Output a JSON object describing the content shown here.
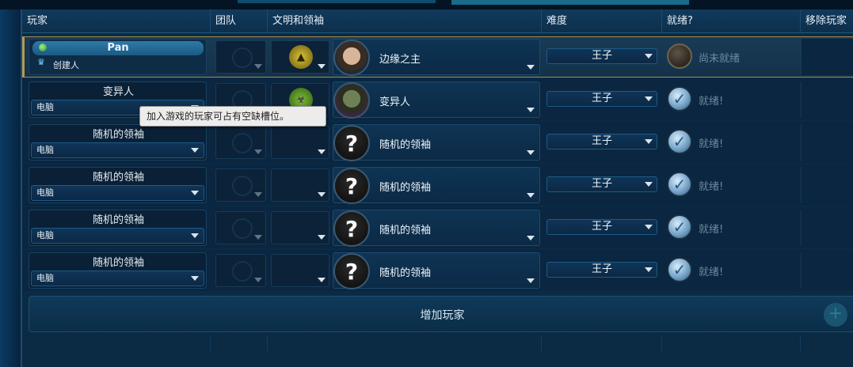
{
  "headers": {
    "player": "玩家",
    "team": "团队",
    "civ_leader": "文明和领袖",
    "difficulty": "难度",
    "ready": "就绪?",
    "remove": "移除玩家"
  },
  "rows": [
    {
      "name": "Pan",
      "subtitle": "创建人",
      "leader": "边缘之主",
      "difficulty": "王子",
      "ready_text": "尚未就绪",
      "ready": false
    },
    {
      "name": "变异人",
      "type": "电脑",
      "leader": "变异人",
      "difficulty": "王子",
      "ready_text": "就绪!",
      "ready": true
    },
    {
      "name": "随机的领袖",
      "type": "电脑",
      "leader": "随机的领袖",
      "difficulty": "王子",
      "ready_text": "就绪!",
      "ready": true
    },
    {
      "name": "随机的领袖",
      "type": "电脑",
      "leader": "随机的领袖",
      "difficulty": "王子",
      "ready_text": "就绪!",
      "ready": true
    },
    {
      "name": "随机的领袖",
      "type": "电脑",
      "leader": "随机的领袖",
      "difficulty": "王子",
      "ready_text": "就绪!",
      "ready": true
    },
    {
      "name": "随机的领袖",
      "type": "电脑",
      "leader": "随机的领袖",
      "difficulty": "王子",
      "ready_text": "就绪!",
      "ready": true
    }
  ],
  "add_player": "增加玩家",
  "tooltip": "加入游戏的玩家可占有空缺槽位。",
  "icons": {
    "unknown_leader": "?",
    "ready_check": "✓",
    "add": "+"
  }
}
